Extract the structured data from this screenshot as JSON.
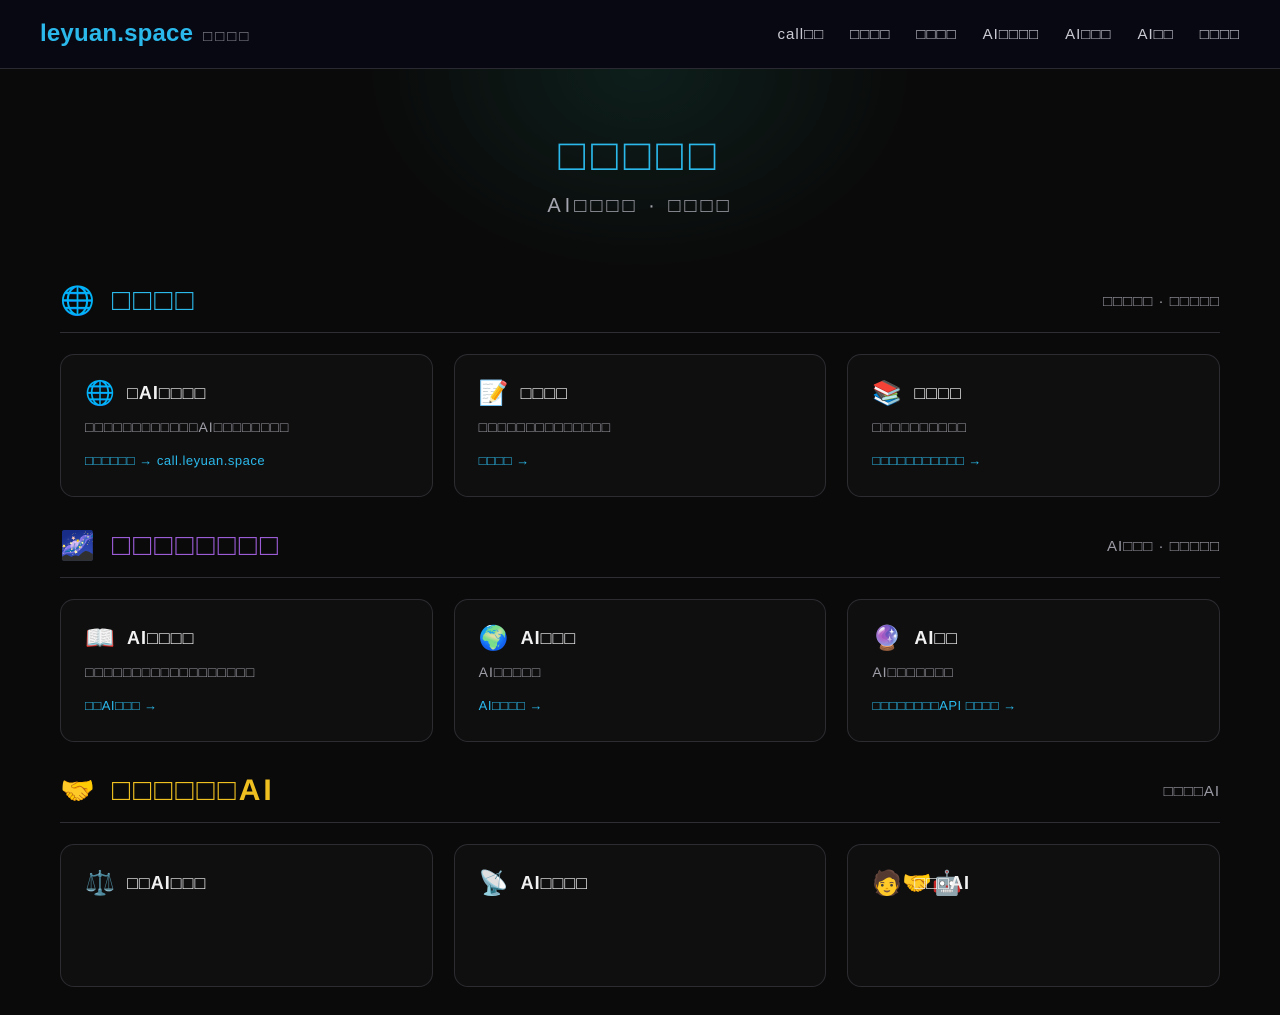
{
  "header": {
    "brand": "leyuan.space",
    "brand_sub": "□□□□",
    "nav": [
      "call□□",
      "□□□□",
      "□□□□",
      "AI□□□□",
      "AI□□□",
      "AI□□",
      "□□□□"
    ]
  },
  "hero": {
    "title": "□□□□□",
    "subtitle": "AI□□□□ · □□□□"
  },
  "sections": [
    {
      "icon": "🌐",
      "title": "□□□□",
      "note": "□□□□□ · □□□□□",
      "cards": [
        {
          "icon": "🌐",
          "title": "□AI□□□□",
          "desc": "□□□□□□□□□□□□AI□□□□□□□□",
          "link": "□□□□□□ → call.leyuan.space"
        },
        {
          "icon": "📝",
          "title": "□□□□",
          "desc": "□□□□□□□□□□□□□□",
          "link": "□□□□ →"
        },
        {
          "icon": "📚",
          "title": "□□□□",
          "desc": "□□□□□□□□□□",
          "link": "□□□□□□□□□□□ →"
        }
      ]
    },
    {
      "icon": "🌌",
      "title": "□□□□□□□□",
      "note": "AI□□□ · □□□□□",
      "cards": [
        {
          "icon": "📖",
          "title": "AI□□□□",
          "desc": "□□□□□□□□□□□□□□□□□□",
          "link": "□□AI□□□ →"
        },
        {
          "icon": "🌍",
          "title": "AI□□□",
          "desc": "AI□□□□□",
          "link": "AI□□□□ →"
        },
        {
          "icon": "🔮",
          "title": "AI□□",
          "desc": "AI□□□□□□□",
          "link": "□□□□□□□□API □□□□ →"
        }
      ]
    },
    {
      "icon": "🤝",
      "title": "□□□□□□AI",
      "note": "□□□□AI",
      "cards": [
        {
          "icon": "⚖️",
          "title": "□□AI□□□",
          "desc": "",
          "link": ""
        },
        {
          "icon": "📡",
          "title": "AI□□□□",
          "desc": "",
          "link": ""
        },
        {
          "icon": "🧑‍🤝‍🤖",
          "title": "□□□AI",
          "desc": "",
          "link": ""
        }
      ]
    }
  ]
}
